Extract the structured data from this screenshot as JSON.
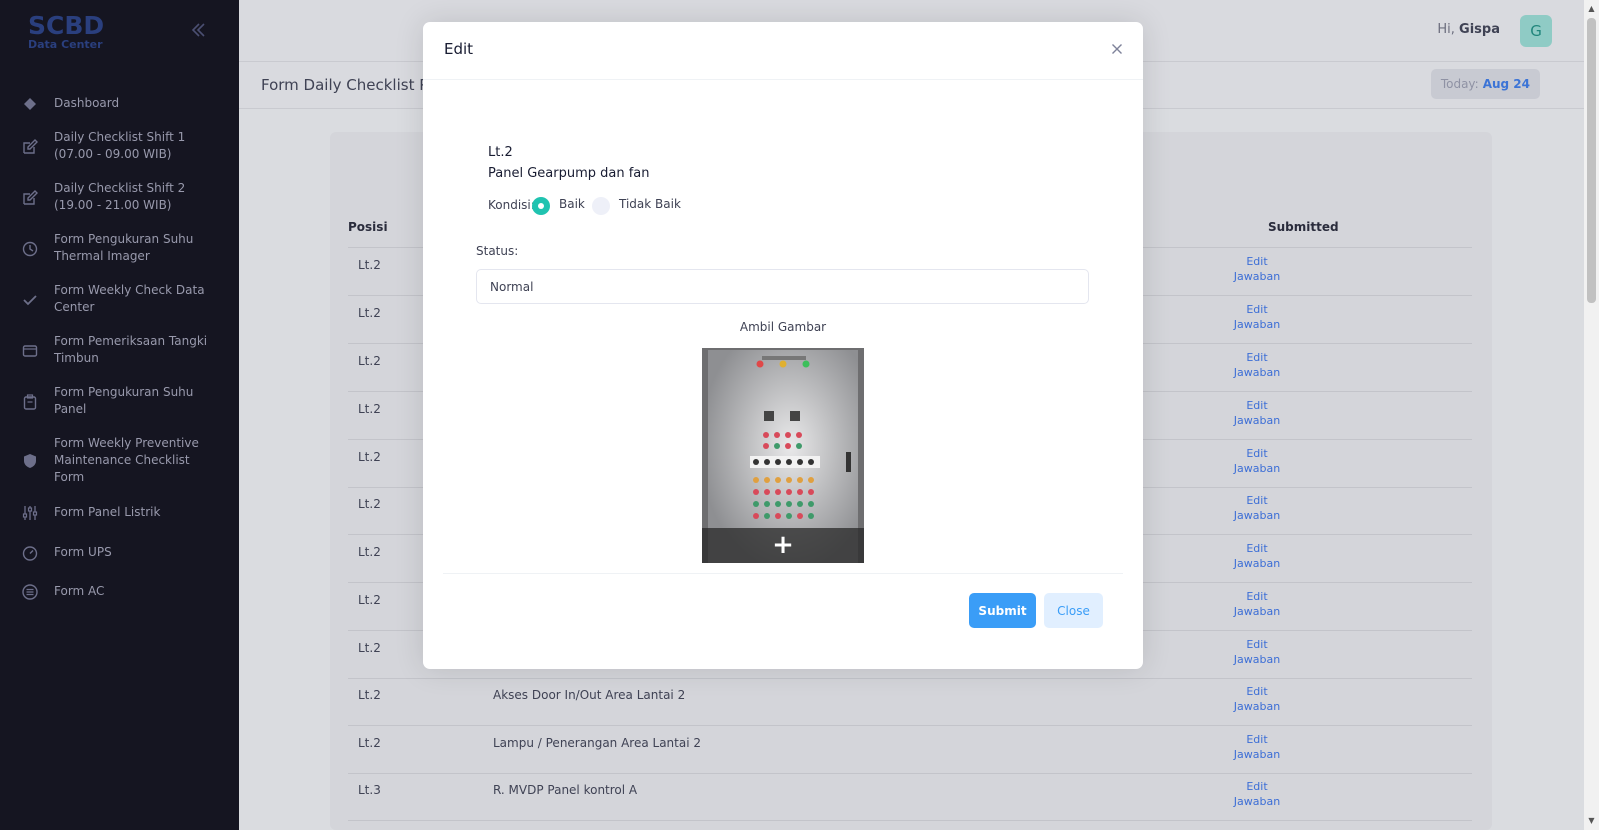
{
  "brand": {
    "title": "SCBD",
    "subtitle": "Data Center"
  },
  "sidebar": {
    "items": [
      {
        "label": "Dashboard",
        "icon": "dashboard-icon"
      },
      {
        "label": "Daily Checklist Shift 1 (07.00 - 09.00 WIB)",
        "icon": "edit-icon"
      },
      {
        "label": "Daily Checklist Shift 2 (19.00 - 21.00 WIB)",
        "icon": "edit-icon"
      },
      {
        "label": "Form Pengukuran Suhu Thermal Imager",
        "icon": "timer-icon"
      },
      {
        "label": "Form Weekly Check Data Center",
        "icon": "check-icon"
      },
      {
        "label": "Form Pemeriksaan Tangki Timbun",
        "icon": "folder-icon"
      },
      {
        "label": "Form Pengukuran Suhu Panel",
        "icon": "clipboard-icon"
      },
      {
        "label": "Form Weekly Preventive Maintenance Checklist Form",
        "icon": "shield-icon"
      },
      {
        "label": "Form Panel Listrik",
        "icon": "sliders-icon"
      },
      {
        "label": "Form UPS",
        "icon": "gauge-icon"
      },
      {
        "label": "Form AC",
        "icon": "list-circle-icon"
      }
    ]
  },
  "header": {
    "greeting": "Hi,",
    "user": "Gispa",
    "avatar_letter": "G",
    "page_title": "Form Daily Checklist P",
    "today_label": "Today:",
    "today_date": "Aug 24"
  },
  "table": {
    "col_posisi": "Posisi",
    "col_submitted": "Submitted",
    "action_line1": "Edit",
    "action_line2": "Jawaban",
    "rows": [
      {
        "posisi": "Lt.2",
        "name": ""
      },
      {
        "posisi": "Lt.2",
        "name": ""
      },
      {
        "posisi": "Lt.2",
        "name": ""
      },
      {
        "posisi": "Lt.2",
        "name": ""
      },
      {
        "posisi": "Lt.2",
        "name": ""
      },
      {
        "posisi": "Lt.2",
        "name": ""
      },
      {
        "posisi": "Lt.2",
        "name": ""
      },
      {
        "posisi": "Lt.2",
        "name": ""
      },
      {
        "posisi": "Lt.2",
        "name": ""
      },
      {
        "posisi": "Lt.2",
        "name": "Akses Door In/Out Area Lantai 2"
      },
      {
        "posisi": "Lt.2",
        "name": "Lampu / Penerangan Area Lantai 2"
      },
      {
        "posisi": "Lt.3",
        "name": "R. MVDP Panel kontrol A"
      }
    ]
  },
  "modal": {
    "title": "Edit",
    "position": "Lt.2",
    "item_name": "Panel Gearpump dan fan",
    "kondisi_label": "Kondisi:",
    "option_good": "Baik",
    "option_bad": "Tidak Baik",
    "selected": "Baik",
    "status_label": "Status:",
    "status_value": "Normal",
    "photo_caption": "Ambil Gambar",
    "submit_label": "Submit",
    "close_label": "Close"
  },
  "colors": {
    "sidebar_bg": "#151521",
    "accent_blue": "#3a9df7",
    "radio_selected": "#20c3b0",
    "avatar_bg": "#8fcbc5"
  }
}
